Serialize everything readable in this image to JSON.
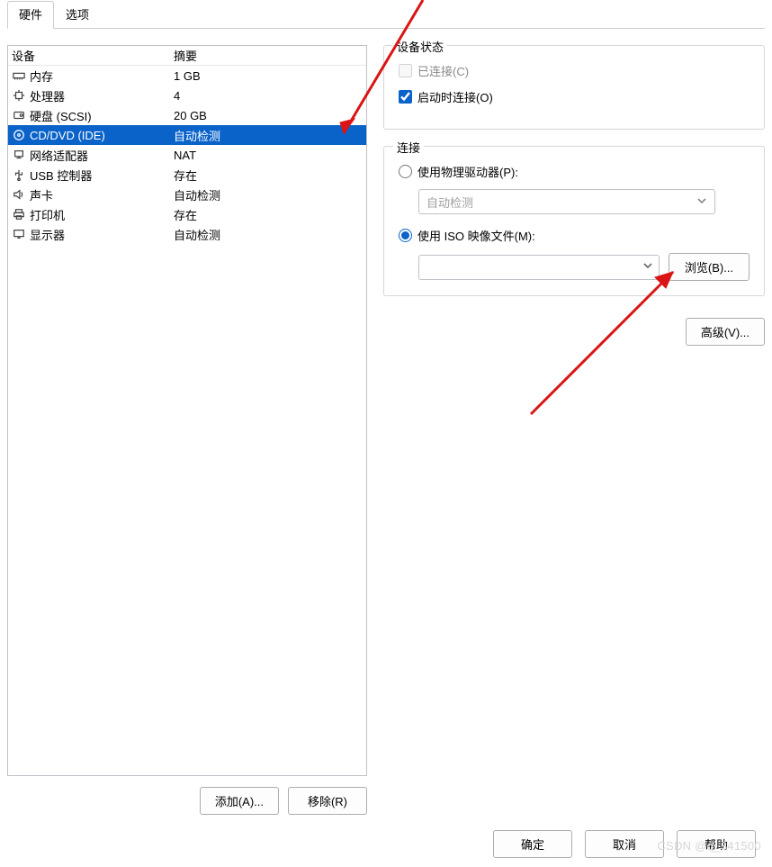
{
  "tabs": {
    "hardware": "硬件",
    "options": "选项"
  },
  "headers": {
    "device": "设备",
    "summary": "摘要"
  },
  "hardware": [
    {
      "icon": "memory-icon",
      "name": "内存",
      "summary": "1 GB"
    },
    {
      "icon": "cpu-icon",
      "name": "处理器",
      "summary": "4"
    },
    {
      "icon": "disk-icon",
      "name": "硬盘 (SCSI)",
      "summary": "20 GB"
    },
    {
      "icon": "cd-icon",
      "name": "CD/DVD (IDE)",
      "summary": "自动检测",
      "selected": true
    },
    {
      "icon": "network-icon",
      "name": "网络适配器",
      "summary": "NAT"
    },
    {
      "icon": "usb-icon",
      "name": "USB 控制器",
      "summary": "存在"
    },
    {
      "icon": "sound-icon",
      "name": "声卡",
      "summary": "自动检测"
    },
    {
      "icon": "printer-icon",
      "name": "打印机",
      "summary": "存在"
    },
    {
      "icon": "display-icon",
      "name": "显示器",
      "summary": "自动检测"
    }
  ],
  "left_buttons": {
    "add": "添加(A)...",
    "remove": "移除(R)"
  },
  "device_status": {
    "legend": "设备状态",
    "connected": "已连接(C)",
    "connect_on_power": "启动时连接(O)"
  },
  "connection": {
    "legend": "连接",
    "use_physical": "使用物理驱动器(P):",
    "physical_value": "自动检测",
    "use_iso": "使用 ISO 映像文件(M):",
    "iso_value": "",
    "browse": "浏览(B)..."
  },
  "advanced": "高级(V)...",
  "bottom": {
    "ok": "确定",
    "cancel": "取消",
    "help": "帮助"
  },
  "watermark": "CSDN @q_341500"
}
